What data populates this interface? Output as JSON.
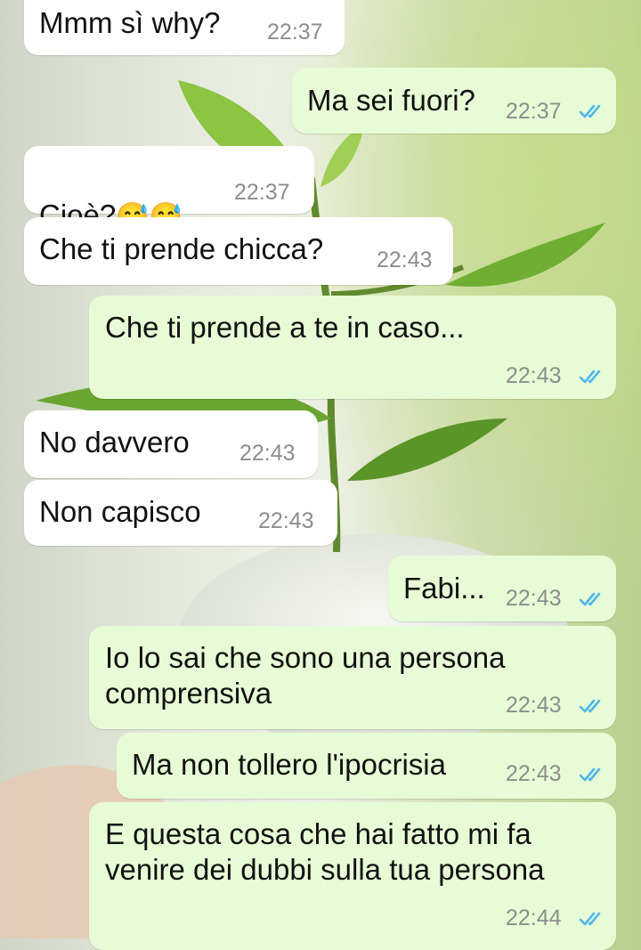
{
  "messages": [
    {
      "dir": "in",
      "text": "Mmm sì why?",
      "time": "22:37"
    },
    {
      "dir": "out",
      "text": "Ma sei fuori?",
      "time": "22:37",
      "status": "read"
    },
    {
      "dir": "in",
      "text": "Cioè?",
      "emoji": "😅😅",
      "time": "22:37"
    },
    {
      "dir": "in",
      "text": "Che ti prende chicca?",
      "time": "22:43"
    },
    {
      "dir": "out",
      "text": "Che ti prende a te in caso...",
      "time": "22:43",
      "status": "read"
    },
    {
      "dir": "in",
      "text": "No davvero",
      "time": "22:43"
    },
    {
      "dir": "in",
      "text": "Non capisco",
      "time": "22:43"
    },
    {
      "dir": "out",
      "text": "Fabi...",
      "time": "22:43",
      "status": "read"
    },
    {
      "dir": "out",
      "text": "Io lo sai che sono una persona\ncomprensiva",
      "time": "22:43",
      "status": "read"
    },
    {
      "dir": "out",
      "text": "Ma non tollero l'ipocrisia",
      "time": "22:43",
      "status": "read"
    },
    {
      "dir": "out",
      "text": "E questa cosa che hai fatto mi fa\nvenire dei dubbi sulla tua persona",
      "time": "22:44",
      "status": "read"
    }
  ],
  "colors": {
    "incoming_bubble": "#ffffff",
    "outgoing_bubble": "#e7fcd6",
    "read_tick": "#4fb6ec",
    "timestamp": "#8a8f8c"
  },
  "icons": {
    "read_receipt": "double-check-icon"
  }
}
